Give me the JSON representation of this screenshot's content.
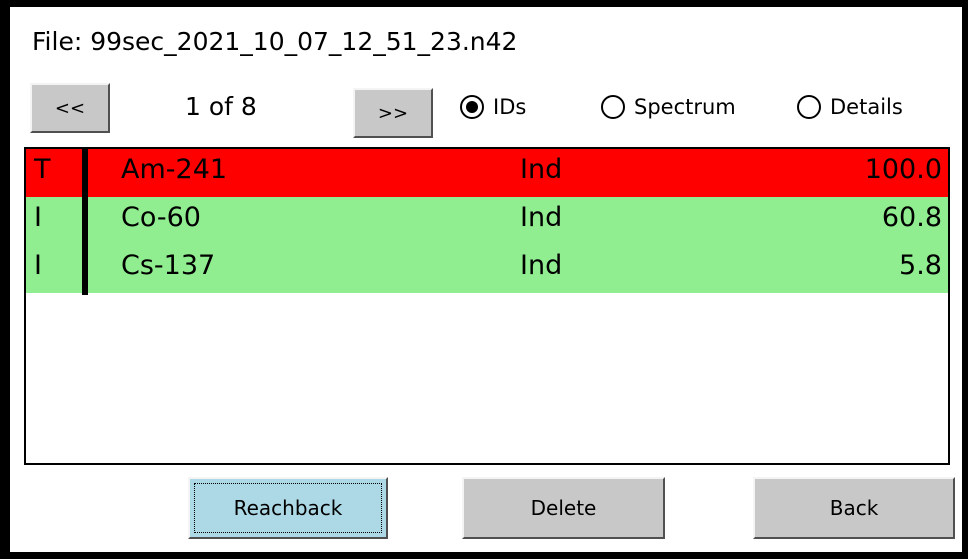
{
  "file": {
    "label": "File: 99sec_2021_10_07_12_51_23.n42"
  },
  "nav": {
    "prev_label": "<<",
    "next_label": ">>",
    "page_indicator": "1 of 8"
  },
  "view_modes": [
    {
      "label": "IDs",
      "selected": true
    },
    {
      "label": "Spectrum",
      "selected": false
    },
    {
      "label": "Details",
      "selected": false
    }
  ],
  "identifications": {
    "rows": [
      {
        "type": "T",
        "nuclide": "Am-241",
        "category": "Ind",
        "value": "100.0",
        "color": "#ff0000"
      },
      {
        "type": "I",
        "nuclide": "Co-60",
        "category": "Ind",
        "value": "60.8",
        "color": "#90ee90"
      },
      {
        "type": "I",
        "nuclide": "Cs-137",
        "category": "Ind",
        "value": "5.8",
        "color": "#90ee90"
      }
    ]
  },
  "actions": {
    "reachback_label": "Reachback",
    "delete_label": "Delete",
    "back_label": "Back"
  }
}
